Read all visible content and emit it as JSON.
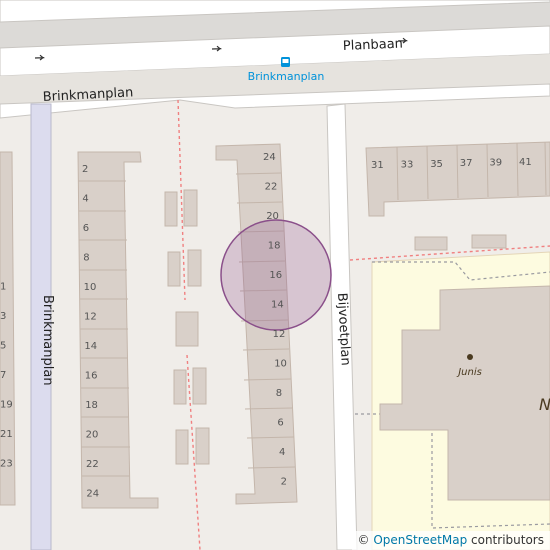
{
  "map": {
    "streets": {
      "planbaan": "Planbaan",
      "brinkmanplan_top": "Brinkmanplan",
      "brinkmanplan_vertical": "Brinkmanplan",
      "bijvoetplan": "Bijvoetplan"
    },
    "bus_stop": {
      "label": "Brinkmanplan",
      "icon": "bus-stop-icon"
    },
    "poi": {
      "label": "Junis"
    },
    "partial_label": "N",
    "house_numbers": {
      "left_column_edge": [
        "1",
        "3",
        "5",
        "7",
        "9",
        "21",
        "23"
      ],
      "left_column_edge_cut": [
        "",
        "1",
        "3",
        "5",
        "7",
        "19",
        "21",
        "23"
      ],
      "block_left": [
        "2",
        "4",
        "6",
        "8",
        "10",
        "12",
        "14",
        "16",
        "18",
        "20",
        "22",
        "24"
      ],
      "block_middle": [
        "24",
        "22",
        "20",
        "18",
        "16",
        "14",
        "12",
        "10",
        "8",
        "6",
        "4",
        "2"
      ],
      "block_right_top": [
        "31",
        "33",
        "35",
        "37",
        "39",
        "41"
      ]
    },
    "colors": {
      "background": "#f0ede9",
      "road": "#ffffff",
      "building": "#d9d0c9",
      "building_stroke": "#c4b6ab",
      "school_area": "#ffffe5",
      "highlight_circle": "#8a4f8a",
      "footpath": "#fa8072"
    }
  },
  "attribution": {
    "prefix": "©",
    "link_text": "OpenStreetMap",
    "suffix": "contributors"
  }
}
